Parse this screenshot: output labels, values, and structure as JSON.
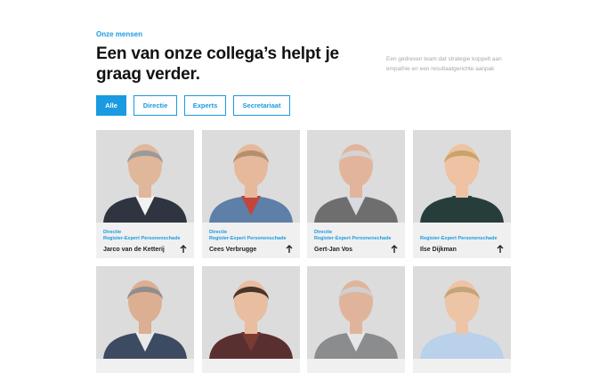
{
  "header": {
    "eyebrow": "Onze mensen",
    "title": "Een van onze collega’s helpt je graag verder.",
    "intro": "Een gedreven team dat strategie koppelt aan empathie en een resultaatgerichte aanpak"
  },
  "filters": [
    "Alle",
    "Directie",
    "Experts",
    "Secretariaat"
  ],
  "active_filter": "Alle",
  "people": [
    {
      "name": "Jarco van de Ketterij",
      "roles": [
        "Directie",
        "Register-Expert Personenschade"
      ],
      "colors": {
        "bg": "#dcdcdc",
        "skin": "#e0b79a",
        "hair": "#9a9a9a",
        "suit": "#2f3540",
        "shirt": "#f2f2f2"
      }
    },
    {
      "name": "Cees Verbrugge",
      "roles": [
        "Directie",
        "Register-Expert Personenschade"
      ],
      "colors": {
        "bg": "#dcdcdc",
        "skin": "#e6b89c",
        "hair": "#b58f6d",
        "suit": "#5d7fa8",
        "shirt": "#c0463e"
      }
    },
    {
      "name": "Gert-Jan Vos",
      "roles": [
        "Directie",
        "Register-Expert Personenschade"
      ],
      "colors": {
        "bg": "#dcdcdc",
        "skin": "#e2b49c",
        "hair": "#d4d4d4",
        "suit": "#6e6e6e",
        "shirt": "#d6dbe2"
      }
    },
    {
      "name": "Ilse Dijkman",
      "roles": [
        "Register-Expert Personenschade"
      ],
      "colors": {
        "bg": "#dcdcdc",
        "skin": "#eec2a2",
        "hair": "#c9a46a",
        "suit": "#263d3b",
        "shirt": "#263d3b"
      }
    },
    {
      "name": "",
      "roles": [],
      "colors": {
        "bg": "#dcdcdc",
        "skin": "#dcae92",
        "hair": "#8e8e8e",
        "suit": "#3c4a62",
        "shirt": "#e8e8e8"
      }
    },
    {
      "name": "",
      "roles": [],
      "colors": {
        "bg": "#dcdcdc",
        "skin": "#e8bda0",
        "hair": "#4a3428",
        "suit": "#5a2f30",
        "shirt": "#7a3a34"
      }
    },
    {
      "name": "",
      "roles": [],
      "colors": {
        "bg": "#dcdcdc",
        "skin": "#e0b49a",
        "hair": "#cfcfcf",
        "suit": "#8a8c8e",
        "shirt": "#e6e6e6"
      }
    },
    {
      "name": "",
      "roles": [],
      "colors": {
        "bg": "#dcdcdc",
        "skin": "#eec4a6",
        "hair": "#c3a47a",
        "suit": "#b9d1ea",
        "shirt": "#b9d1ea"
      }
    }
  ],
  "accent": "#1a9ae0"
}
